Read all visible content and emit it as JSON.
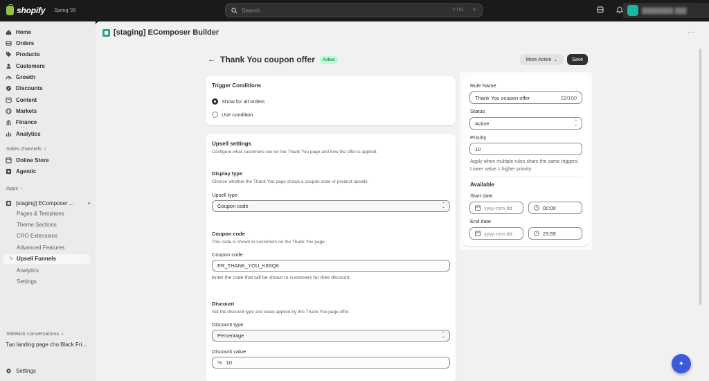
{
  "topbar": {
    "brand": "shopify",
    "edition": "Spring '26",
    "search_placeholder": "Search",
    "search_shortcut_key1": "CTRL",
    "search_shortcut_key2": "K"
  },
  "sidebar": {
    "items": [
      {
        "label": "Home",
        "icon": "home-icon"
      },
      {
        "label": "Orders",
        "icon": "orders-icon"
      },
      {
        "label": "Products",
        "icon": "tag-icon"
      },
      {
        "label": "Customers",
        "icon": "person-icon"
      },
      {
        "label": "Growth",
        "icon": "growth-icon"
      },
      {
        "label": "Discounts",
        "icon": "discount-icon"
      },
      {
        "label": "Content",
        "icon": "content-icon"
      },
      {
        "label": "Markets",
        "icon": "globe-icon"
      },
      {
        "label": "Finance",
        "icon": "bank-icon"
      },
      {
        "label": "Analytics",
        "icon": "chart-icon"
      }
    ],
    "sales_channels_label": "Sales channels",
    "channels": [
      {
        "label": "Online Store",
        "icon": "store-icon"
      },
      {
        "label": "Agentic",
        "icon": "agentic-icon"
      }
    ],
    "apps_label": "Apps",
    "app_name": "[staging] EComposer ...",
    "app_subitems": [
      "Pages & Templates",
      "Theme Sections",
      "CRO Extensions",
      "Advanced Features",
      "Upsell Funnels",
      "Analytics",
      "Settings"
    ],
    "sidekick_label": "Sidekick conversations",
    "sidekick_item": "Tạo landing page cho Black Fri...",
    "settings_label": "Settings"
  },
  "app_header": {
    "title": "[staging] EComposer Builder"
  },
  "page": {
    "title": "Thank You coupon offer",
    "status_badge": "Active",
    "more_action_label": "More Action",
    "save_label": "Save"
  },
  "trigger": {
    "title": "Trigger Conditions",
    "options": [
      "Show for all orders",
      "Use condition"
    ],
    "selected": "Show for all orders"
  },
  "upsell": {
    "title": "Upsell settings",
    "desc": "Configure what customers see on the Thank You page and how the offer is applied.",
    "display_type_title": "Display type",
    "display_type_desc": "Choose whether the Thank You page shows a coupon code or product upsells.",
    "upsell_type_label": "Upsell type",
    "upsell_type_value": "Coupon code",
    "coupon_title": "Coupon code",
    "coupon_desc": "This code is shown to customers on the Thank You page.",
    "coupon_label": "Coupon code",
    "coupon_value": "ER_THANK_YOU_K8SQ6",
    "coupon_help": "Enter the code that will be shown to customers for their discount.",
    "discount_title": "Discount",
    "discount_desc": "Set the discount type and value applied by this Thank You page offer.",
    "discount_type_label": "Discount type",
    "discount_type_value": "Percentage",
    "discount_value_label": "Discount value",
    "discount_prefix": "%",
    "discount_value": "10"
  },
  "rule": {
    "name_label": "Rule Name",
    "name_value": "Thank You coupon offer",
    "name_count": "22/100",
    "status_label": "Status",
    "status_value": "Active",
    "priority_label": "Priority",
    "priority_value": "10",
    "priority_help": "Apply when multiple rules share the same triggers. Lower value = higher priority.",
    "available_title": "Available",
    "start_label": "Start date",
    "start_date_placeholder": "yyyy-mm-dd",
    "start_time": "00:00",
    "end_label": "End date",
    "end_date_placeholder": "yyyy-mm-dd",
    "end_time": "23:59"
  },
  "colors": {
    "topbar": "#1a1a1a",
    "active_badge": "#b4fed2",
    "primary_button": "#303030",
    "fab": "#3b5bdb"
  }
}
